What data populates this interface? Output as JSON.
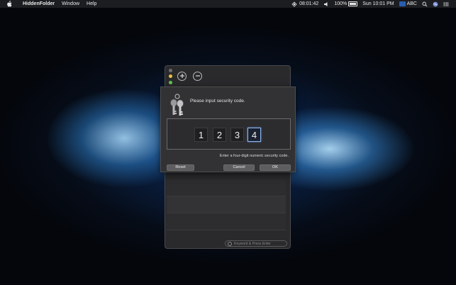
{
  "menubar": {
    "app_name": "HiddenFolder",
    "menus": [
      "Window",
      "Help"
    ],
    "timer": "08:01:42",
    "battery": "100%",
    "clock": "Sun 10:01 PM",
    "input_source": "ABC",
    "icons": [
      "apple-icon",
      "timer-icon",
      "volume-icon",
      "battery-icon",
      "search-icon",
      "siri-icon",
      "notification-center-icon"
    ]
  },
  "main_window": {
    "search_placeholder": "Keyword & Press Enter",
    "list_rows": 3
  },
  "dialog": {
    "prompt": "Please input security code.",
    "digits": [
      "1",
      "2",
      "3",
      "4"
    ],
    "active_digit_index": 3,
    "hint": "Enter a four-digit numeric security code.",
    "reset_label": "Reset",
    "cancel_label": "Cancel",
    "ok_label": "OK"
  },
  "colors": {
    "focus_ring": "#8db4ee",
    "traffic_minimize": "#e7c33e",
    "traffic_zoom": "#62c454"
  }
}
